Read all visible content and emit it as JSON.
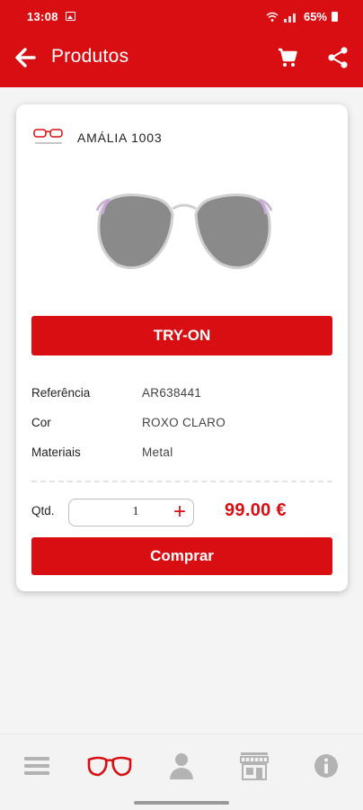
{
  "status_bar": {
    "time": "13:08",
    "battery": "65%"
  },
  "header": {
    "title": "Produtos"
  },
  "product": {
    "name": "AMÁLIA 1003",
    "try_on_label": "TRY-ON",
    "specs": [
      {
        "label": "Referência",
        "value": "AR638441"
      },
      {
        "label": "Cor",
        "value": "ROXO CLARO"
      },
      {
        "label": "Materiais",
        "value": "Metal"
      }
    ],
    "quantity_label": "Qtd.",
    "quantity": "1",
    "price": "99.00 €",
    "buy_label": "Comprar"
  },
  "bottom_nav": [
    {
      "icon": "menu-icon",
      "active": false
    },
    {
      "icon": "glasses-icon",
      "active": true
    },
    {
      "icon": "user-icon",
      "active": false
    },
    {
      "icon": "store-icon",
      "active": false
    },
    {
      "icon": "info-icon",
      "active": false
    }
  ],
  "colors": {
    "brand": "#d80e12",
    "inactive_icon": "#b3b3b3"
  }
}
